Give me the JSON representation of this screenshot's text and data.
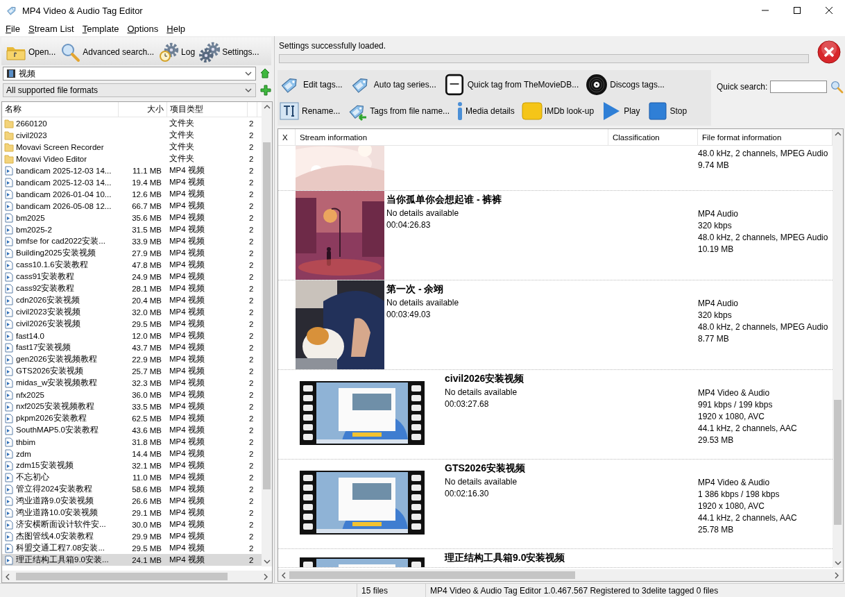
{
  "window": {
    "title": "MP4 Video & Audio Tag Editor"
  },
  "menu": [
    {
      "label": "File"
    },
    {
      "label": "Stream List"
    },
    {
      "label": "Template"
    },
    {
      "label": "Options"
    },
    {
      "label": "Help"
    }
  ],
  "toolbar": [
    {
      "kind": "folder",
      "label": "Open..."
    },
    {
      "kind": "search",
      "label": "Advanced search..."
    },
    {
      "kind": "log",
      "label": "Log"
    },
    {
      "kind": "settings",
      "label": "Settings..."
    }
  ],
  "folder_combo": {
    "value": "视频"
  },
  "format_combo": {
    "value": "All supported file formats"
  },
  "files": {
    "columns": [
      "名称",
      "大小",
      "项目类型"
    ],
    "rows": [
      {
        "kind": "folder",
        "name": "2660120",
        "type": "文件夹",
        "column_4": "2",
        "selected": false
      },
      {
        "kind": "folder",
        "name": "civil2023",
        "type": "文件夹",
        "column_4": "2",
        "selected": false
      },
      {
        "kind": "folder",
        "name": "Movavi Screen Recorder",
        "type": "文件夹",
        "column_4": "2",
        "selected": false
      },
      {
        "kind": "folder",
        "name": "Movavi Video Editor",
        "type": "文件夹",
        "column_4": "2",
        "selected": false
      },
      {
        "kind": "video",
        "name": "bandicam 2025-12-03 14...",
        "size": "11.1 MB",
        "type": "MP4 视频",
        "column_4": "2",
        "selected": false
      },
      {
        "kind": "video",
        "name": "bandicam 2025-12-03 14...",
        "size": "19.4 MB",
        "type": "MP4 视频",
        "column_4": "2",
        "selected": false
      },
      {
        "kind": "video",
        "name": "bandicam 2026-01-04 10...",
        "size": "12.6 MB",
        "type": "MP4 视频",
        "column_4": "2",
        "selected": false
      },
      {
        "kind": "video",
        "name": "bandicam 2026-05-08 12...",
        "size": "66.7 MB",
        "type": "MP4 视频",
        "column_4": "2",
        "selected": false
      },
      {
        "kind": "video",
        "name": "bm2025",
        "size": "35.6 MB",
        "type": "MP4 视频",
        "column_4": "2",
        "selected": false
      },
      {
        "kind": "video",
        "name": "bm2025-2",
        "size": "31.5 MB",
        "type": "MP4 视频",
        "column_4": "2",
        "selected": false
      },
      {
        "kind": "video",
        "name": "bmfse for cad2022安装...",
        "size": "33.9 MB",
        "type": "MP4 视频",
        "column_4": "2",
        "selected": false
      },
      {
        "kind": "video",
        "name": "Building2025安装视频",
        "size": "27.9 MB",
        "type": "MP4 视频",
        "column_4": "2",
        "selected": false
      },
      {
        "kind": "video",
        "name": "cass10.1.6安装教程",
        "size": "47.8 MB",
        "type": "MP4 视频",
        "column_4": "2",
        "selected": false
      },
      {
        "kind": "video",
        "name": "cass91安装教程",
        "size": "24.9 MB",
        "type": "MP4 视频",
        "column_4": "2",
        "selected": false
      },
      {
        "kind": "video",
        "name": "cass92安装教程",
        "size": "28.1 MB",
        "type": "MP4 视频",
        "column_4": "2",
        "selected": false
      },
      {
        "kind": "video",
        "name": "cdn2026安装视频",
        "size": "20.4 MB",
        "type": "MP4 视频",
        "column_4": "2",
        "selected": false
      },
      {
        "kind": "video",
        "name": "civil2023安装视频",
        "size": "32.0 MB",
        "type": "MP4 视频",
        "column_4": "2",
        "selected": false
      },
      {
        "kind": "video",
        "name": "civil2026安装视频",
        "size": "29.5 MB",
        "type": "MP4 视频",
        "column_4": "2",
        "selected": false
      },
      {
        "kind": "video",
        "name": "fast14.0",
        "size": "12.0 MB",
        "type": "MP4 视频",
        "column_4": "2",
        "selected": false
      },
      {
        "kind": "video",
        "name": "fast17安装视频",
        "size": "43.7 MB",
        "type": "MP4 视频",
        "column_4": "2",
        "selected": false
      },
      {
        "kind": "video",
        "name": "gen2026安装视频教程",
        "size": "22.9 MB",
        "type": "MP4 视频",
        "column_4": "2",
        "selected": false
      },
      {
        "kind": "video",
        "name": "GTS2026安装视频",
        "size": "25.7 MB",
        "type": "MP4 视频",
        "column_4": "2",
        "selected": false
      },
      {
        "kind": "video",
        "name": "midas_w安装视频教程",
        "size": "32.3 MB",
        "type": "MP4 视频",
        "column_4": "2",
        "selected": false
      },
      {
        "kind": "video",
        "name": "nfx2025",
        "size": "36.0 MB",
        "type": "MP4 视频",
        "column_4": "2",
        "selected": false
      },
      {
        "kind": "video",
        "name": "nxf2025安装视频教程",
        "size": "33.5 MB",
        "type": "MP4 视频",
        "column_4": "2",
        "selected": false
      },
      {
        "kind": "video",
        "name": "pkpm2026安装教程",
        "size": "62.5 MB",
        "type": "MP4 视频",
        "column_4": "2",
        "selected": false
      },
      {
        "kind": "video",
        "name": "SouthMAP5.0安装教程",
        "size": "43.6 MB",
        "type": "MP4 视频",
        "column_4": "2",
        "selected": false
      },
      {
        "kind": "video",
        "name": "thbim",
        "size": "31.8 MB",
        "type": "MP4 视频",
        "column_4": "2",
        "selected": false
      },
      {
        "kind": "video",
        "name": "zdm",
        "size": "14.4 MB",
        "type": "MP4 视频",
        "column_4": "2",
        "selected": false
      },
      {
        "kind": "video",
        "name": "zdm15安装视频",
        "size": "32.1 MB",
        "type": "MP4 视频",
        "column_4": "2",
        "selected": false
      },
      {
        "kind": "video",
        "name": "不忘初心",
        "size": "11.0 MB",
        "type": "MP4 视频",
        "column_4": "2",
        "selected": false
      },
      {
        "kind": "video",
        "name": "管立得2024安装教程",
        "size": "58.6 MB",
        "type": "MP4 视频",
        "column_4": "2",
        "selected": false
      },
      {
        "kind": "video",
        "name": "鸿业道路9.0安装视频",
        "size": "26.6 MB",
        "type": "MP4 视频",
        "column_4": "2",
        "selected": false
      },
      {
        "kind": "video",
        "name": "鸿业道路10.0安装视频",
        "size": "29.1 MB",
        "type": "MP4 视频",
        "column_4": "2",
        "selected": false
      },
      {
        "kind": "video",
        "name": "济安横断面设计软件安...",
        "size": "30.0 MB",
        "type": "MP4 视频",
        "column_4": "2",
        "selected": false
      },
      {
        "kind": "video",
        "name": "杰图管线4.0安装教程",
        "size": "29.9 MB",
        "type": "MP4 视频",
        "column_4": "2",
        "selected": false
      },
      {
        "kind": "video",
        "name": "科盟交通工程7.08安装...",
        "size": "29.5 MB",
        "type": "MP4 视频",
        "column_4": "2",
        "selected": false
      },
      {
        "kind": "video",
        "name": "理正结构工具箱9.0安装...",
        "size": "24.1 MB",
        "type": "MP4 视频",
        "column_4": "2",
        "selected": true
      }
    ]
  },
  "message": {
    "text": "Settings successfully loaded.",
    "progress": {
      "level": 0
    }
  },
  "actions": [
    {
      "kind": "mp4-tag",
      "label": "Edit tags..."
    },
    {
      "kind": "number-tag",
      "label": "Auto tag series..."
    },
    {
      "kind": "tmdb",
      "label": "Quick tag from TheMovieDB..."
    },
    {
      "kind": "vinyl",
      "label": "Discogs tags..."
    },
    {
      "kind": "rename",
      "label": "Rename..."
    },
    {
      "kind": "tag-import",
      "label": "Tags from file name..."
    },
    {
      "kind": "info",
      "label": "Media details"
    },
    {
      "kind": "imdb",
      "label": "IMDb look-up"
    },
    {
      "kind": "play",
      "label": "Play"
    },
    {
      "kind": "stop",
      "label": "Stop"
    }
  ],
  "quick_search": {
    "label": "Quick search:"
  },
  "streams": {
    "columns": [
      "X",
      "Stream information",
      "Classification",
      "File format information"
    ],
    "rows": [
      {
        "kind": "cover",
        "format": [
          "48.0 kHz, 2 channels, MPEG Audio",
          "9.74 MB"
        ]
      },
      {
        "kind": "cover",
        "title": "当你孤单你会想起谁 - 裤裤",
        "details": [
          "No details available",
          "00:04:26.83"
        ],
        "format": [
          "MP4 Audio",
          "320 kbps",
          "48.0 kHz, 2 channels, MPEG Audio",
          "10.19 MB"
        ]
      },
      {
        "kind": "cover",
        "title": "第一次 - 余翊",
        "details": [
          "No details available",
          "00:03:49.03"
        ],
        "format": [
          "MP4 Audio",
          "320 kbps",
          "48.0 kHz, 2 channels, MPEG Audio",
          "8.77 MB"
        ]
      },
      {
        "kind": "film",
        "title": "civil2026安装视频",
        "details": [
          "No details available",
          "00:03:27.68"
        ],
        "format": [
          "MP4 Video & Audio",
          "991 kbps / 199 kbps",
          "1920 x 1080, AVC",
          "44.1 kHz, 2 channels, AAC",
          "29.53 MB"
        ]
      },
      {
        "kind": "film",
        "title": "GTS2026安装视频",
        "details": [
          "No details available",
          "00:02:16.30"
        ],
        "format": [
          "MP4 Video & Audio",
          "1 386 kbps / 198 kbps",
          "1920 x 1080, AVC",
          "44.1 kHz, 2 channels, AAC",
          "25.78 MB"
        ]
      },
      {
        "kind": "film",
        "title": "理正结构工具箱9.0安装视频"
      }
    ]
  },
  "status_bar": {
    "count": "15 files",
    "info": "MP4 Video & Audio Tag Editor 1.0.467.567 Registered to 3delite tagged 0 files"
  }
}
